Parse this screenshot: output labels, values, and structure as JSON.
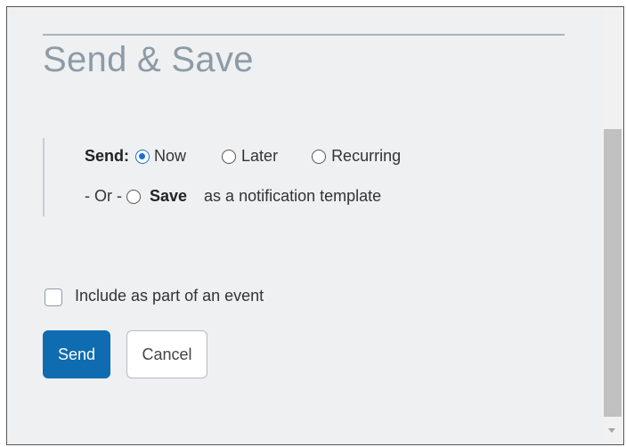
{
  "section": {
    "title": "Send & Save"
  },
  "send_options": {
    "label": "Send:",
    "options": [
      {
        "label": "Now",
        "selected": true
      },
      {
        "label": "Later",
        "selected": false
      },
      {
        "label": "Recurring",
        "selected": false
      }
    ]
  },
  "save_option": {
    "prefix": "- Or -",
    "label": "Save",
    "suffix": "as a notification template",
    "selected": false
  },
  "event": {
    "label": "Include as part of an event",
    "checked": false
  },
  "buttons": {
    "send": "Send",
    "cancel": "Cancel"
  },
  "colors": {
    "accent": "#0f6cb0",
    "title": "#8e9ba6",
    "background": "#eef0f2"
  }
}
